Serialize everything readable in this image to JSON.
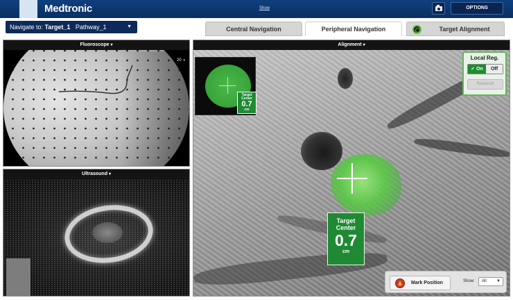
{
  "header": {
    "brand": "Medtronic",
    "center_link": "Show",
    "options_label": "OPTIONS"
  },
  "navigation": {
    "prefix": "Navigate to:",
    "target": "Target_1",
    "pathway": "Pathway_1",
    "caret": "▼"
  },
  "tabs": [
    {
      "label": "Central Navigation",
      "active": false
    },
    {
      "label": "Peripheral Navigation",
      "active": true
    },
    {
      "label": "Target Alignment",
      "active": false
    }
  ],
  "panels": {
    "fluoroscope": {
      "title": "Fluoroscope",
      "badge": "20 ◑"
    },
    "ultrasound": {
      "title": "Ultrasound"
    },
    "alignment": {
      "title": "Alignment"
    }
  },
  "dropdown_glyph": "▾",
  "target": {
    "label_line1": "Target",
    "label_line2": "Center",
    "distance": "0.7",
    "unit": "cm"
  },
  "local_reg": {
    "title": "Local Reg.",
    "on_label": "✓ On",
    "off_label": "Off",
    "relaunch_label": "Relaunch"
  },
  "bottom_bar": {
    "mark_label": "Mark Position",
    "show_label": "Show:",
    "show_value": "All",
    "caret": "▼"
  },
  "colors": {
    "header_blue": "#0a2f63",
    "target_green": "#1f8a33",
    "mark_red": "#c83a2a"
  }
}
